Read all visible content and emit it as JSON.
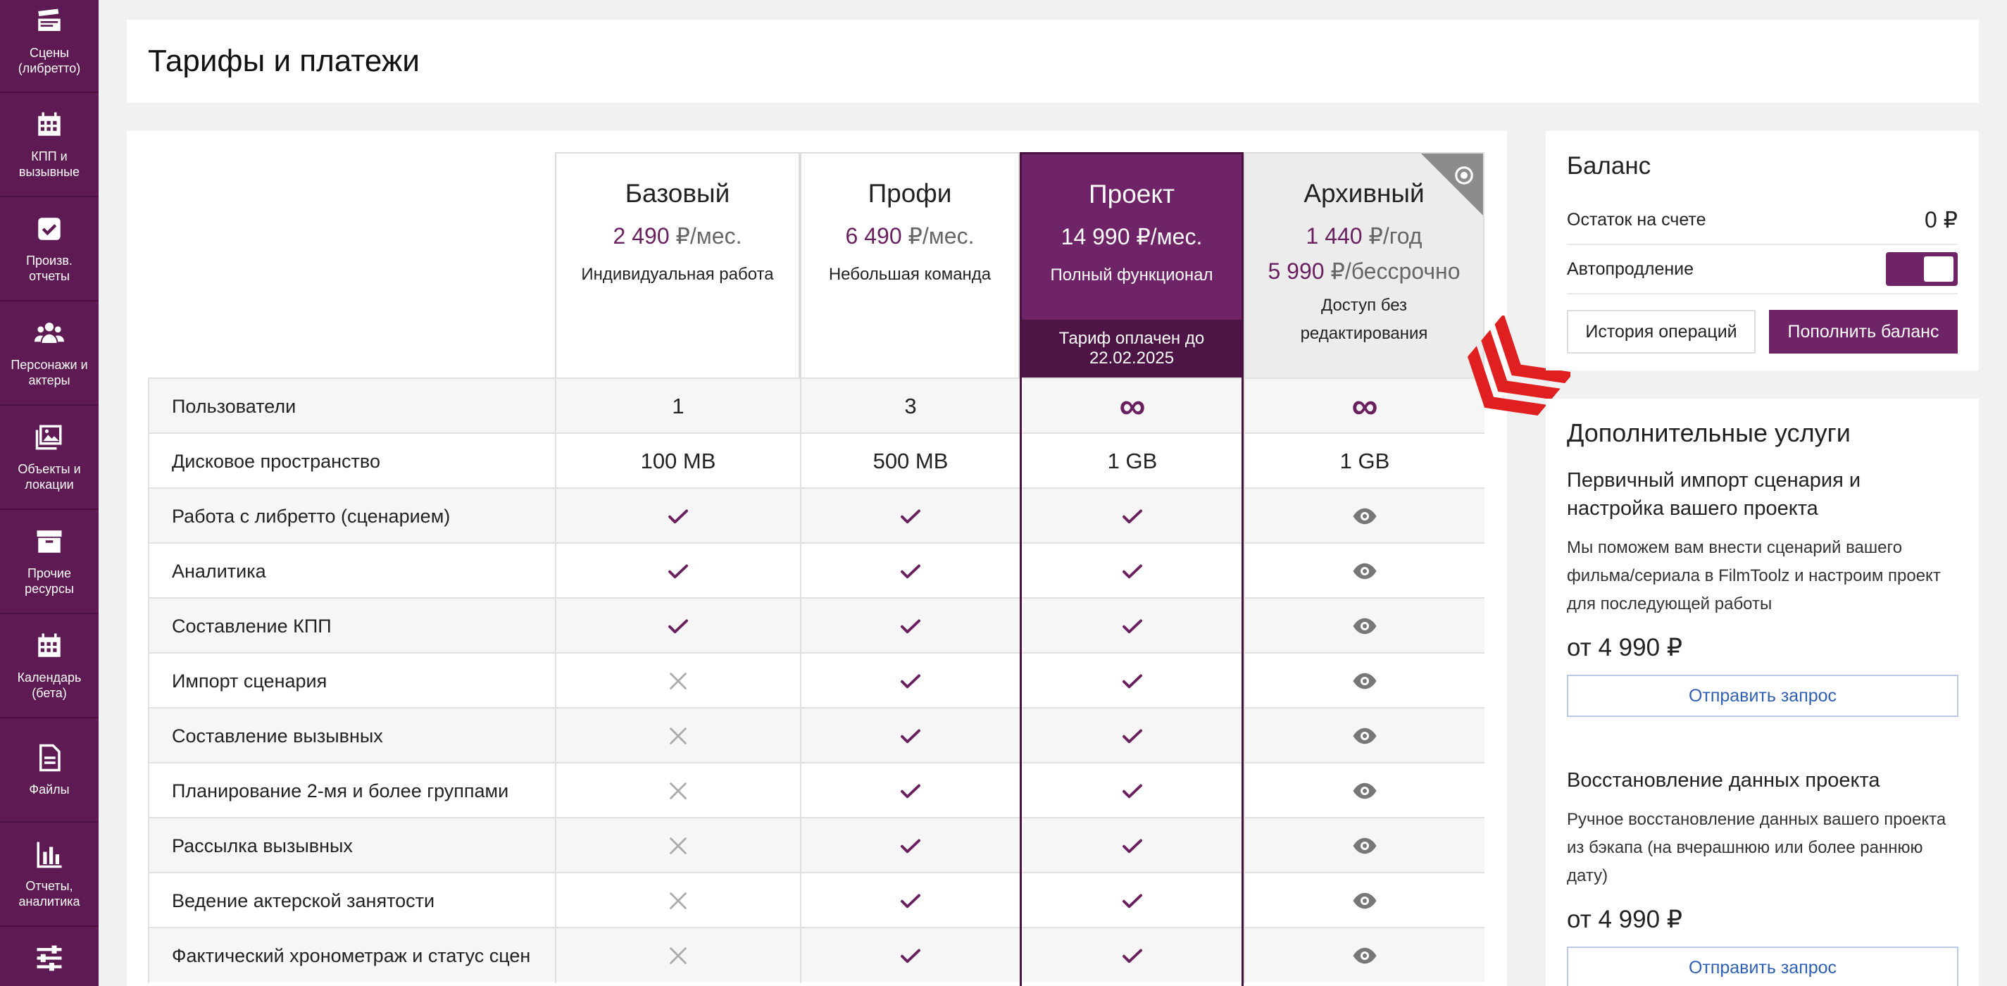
{
  "sidebar": {
    "items": [
      {
        "label": "Сцены (либретто)",
        "icon": "clapperboard-icon"
      },
      {
        "label": "КПП и вызывные",
        "icon": "calendar-icon"
      },
      {
        "label": "Произв. отчеты",
        "icon": "checkbox-icon"
      },
      {
        "label": "Персонажи и актеры",
        "icon": "people-icon"
      },
      {
        "label": "Объекты и локации",
        "icon": "image-icon"
      },
      {
        "label": "Прочие ресурсы",
        "icon": "archive-box-icon"
      },
      {
        "label": "Календарь (бета)",
        "icon": "calendar-icon"
      },
      {
        "label": "Файлы",
        "icon": "file-icon"
      },
      {
        "label": "Отчеты, аналитика",
        "icon": "bar-chart-icon"
      },
      {
        "label": "",
        "icon": "sliders-icon"
      }
    ]
  },
  "header": {
    "title": "Тарифы и платежи"
  },
  "plans": [
    {
      "name": "Базовый",
      "price": "2 490",
      "unit": "₽/мес.",
      "desc": "Индивидуальная работа"
    },
    {
      "name": "Профи",
      "price": "6 490",
      "unit": "₽/мес.",
      "desc": "Небольшая команда"
    },
    {
      "name": "Проект",
      "price": "14 990",
      "unit": "₽/мес.",
      "desc": "Полный функционал",
      "paid": "Тариф оплачен до 22.02.2025"
    },
    {
      "name": "Архивный",
      "price": "1 440",
      "unit": "₽/год",
      "price2": "5 990",
      "unit2": "₽/бессрочно",
      "desc": "Доступ без редактирования"
    }
  ],
  "features": [
    {
      "name": "Пользователи",
      "values": [
        "1",
        "3",
        "∞",
        "∞"
      ]
    },
    {
      "name": "Дисковое пространство",
      "values": [
        "100 MB",
        "500 MB",
        "1 GB",
        "1 GB"
      ]
    },
    {
      "name": "Работа с либретто (сценарием)",
      "values": [
        "check",
        "check",
        "check",
        "eye"
      ]
    },
    {
      "name": "Аналитика",
      "values": [
        "check",
        "check",
        "check",
        "eye"
      ]
    },
    {
      "name": "Составление КПП",
      "values": [
        "check",
        "check",
        "check",
        "eye"
      ]
    },
    {
      "name": "Импорт сценария",
      "values": [
        "cross",
        "check",
        "check",
        "eye"
      ]
    },
    {
      "name": "Составление вызывных",
      "values": [
        "cross",
        "check",
        "check",
        "eye"
      ]
    },
    {
      "name": "Планирование 2-мя и более группами",
      "values": [
        "cross",
        "check",
        "check",
        "eye"
      ]
    },
    {
      "name": "Рассылка вызывных",
      "values": [
        "cross",
        "check",
        "check",
        "eye"
      ]
    },
    {
      "name": "Ведение актерской занятости",
      "values": [
        "cross",
        "check",
        "check",
        "eye"
      ]
    },
    {
      "name": "Фактический хронометраж и статус сцен",
      "values": [
        "cross",
        "check",
        "check",
        "eye"
      ]
    }
  ],
  "balance": {
    "title": "Баланс",
    "remaining_label": "Остаток на счете",
    "remaining_value": "0 ₽",
    "autorenew_label": "Автопродление",
    "autorenew_on": true,
    "history_button": "История операций",
    "topup_button": "Пополнить баланс"
  },
  "services": {
    "title": "Дополнительные услуги",
    "items": [
      {
        "name": "Первичный импорт сценария и настройка вашего проекта",
        "desc": "Мы поможем вам внести сценарий вашего фильма/сериала в FilmToolz и настроим проект для последующей работы",
        "price": "от 4 990 ₽",
        "button": "Отправить запрос"
      },
      {
        "name": "Восстановление данных проекта",
        "desc": "Ручное восстановление данных вашего проекта из бэкапа (на вчерашнюю или более раннюю дату)",
        "price": "от 4 990 ₽",
        "button": "Отправить запрос"
      }
    ]
  },
  "colors": {
    "brand": "#6e2466",
    "sidebar": "#5e1a52",
    "accent_red": "#e02020",
    "link": "#2f5fb3"
  }
}
